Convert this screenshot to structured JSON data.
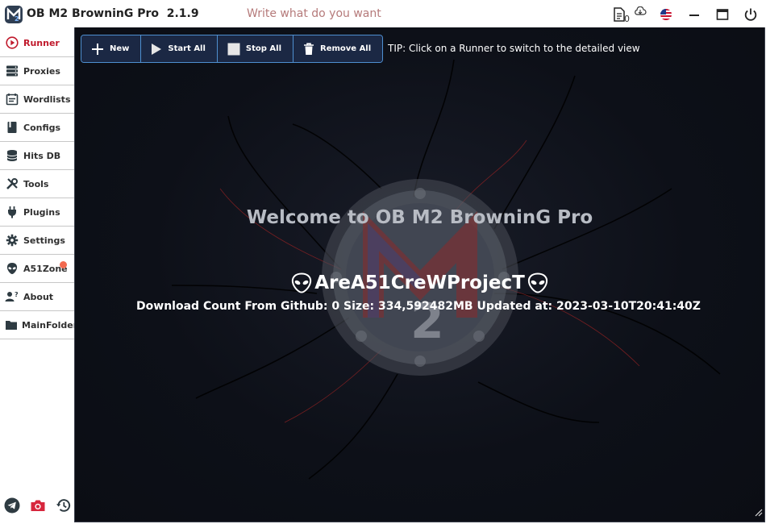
{
  "window": {
    "title": "OB M2 BrowninG Pro  2.1.9",
    "search_placeholder": "Write what do you want",
    "download_count": "0"
  },
  "sidebar": {
    "items": [
      {
        "label": "Runner",
        "icon": "play-circle-icon",
        "active": true
      },
      {
        "label": "Proxies",
        "icon": "server-icon"
      },
      {
        "label": "Wordlists",
        "icon": "calendar-list-icon"
      },
      {
        "label": "Configs",
        "icon": "book-icon"
      },
      {
        "label": "Hits DB",
        "icon": "database-icon"
      },
      {
        "label": "Tools",
        "icon": "tools-icon"
      },
      {
        "label": "Plugins",
        "icon": "plug-icon"
      },
      {
        "label": "Settings",
        "icon": "gear-icon"
      },
      {
        "label": "A51Zone",
        "icon": "alien-icon",
        "badge": true
      },
      {
        "label": "About",
        "icon": "user-question-icon"
      },
      {
        "label": "MainFolder",
        "icon": "folder-icon"
      }
    ],
    "bottom_icons": [
      "telegram-icon",
      "camera-icon",
      "history-icon"
    ]
  },
  "toolbar": {
    "new_label": "New",
    "start_all_label": "Start All",
    "stop_all_label": "Stop All",
    "remove_all_label": "Remove All"
  },
  "tip": "TIP: Click on a Runner to switch to the detailed view",
  "welcome": {
    "title": "Welcome to OB M2 BrowninG Pro",
    "crew": "AreA51CreWProjecT",
    "stats": "Download Count From Github: 0  Size: 334,592482MB  Updated at: 2023-03-10T20:41:40Z"
  },
  "colors": {
    "accent": "#c01a2c",
    "toolbar_border": "#4e8fd0",
    "main_bg": "#0d1018",
    "badge": "#f26a50"
  }
}
